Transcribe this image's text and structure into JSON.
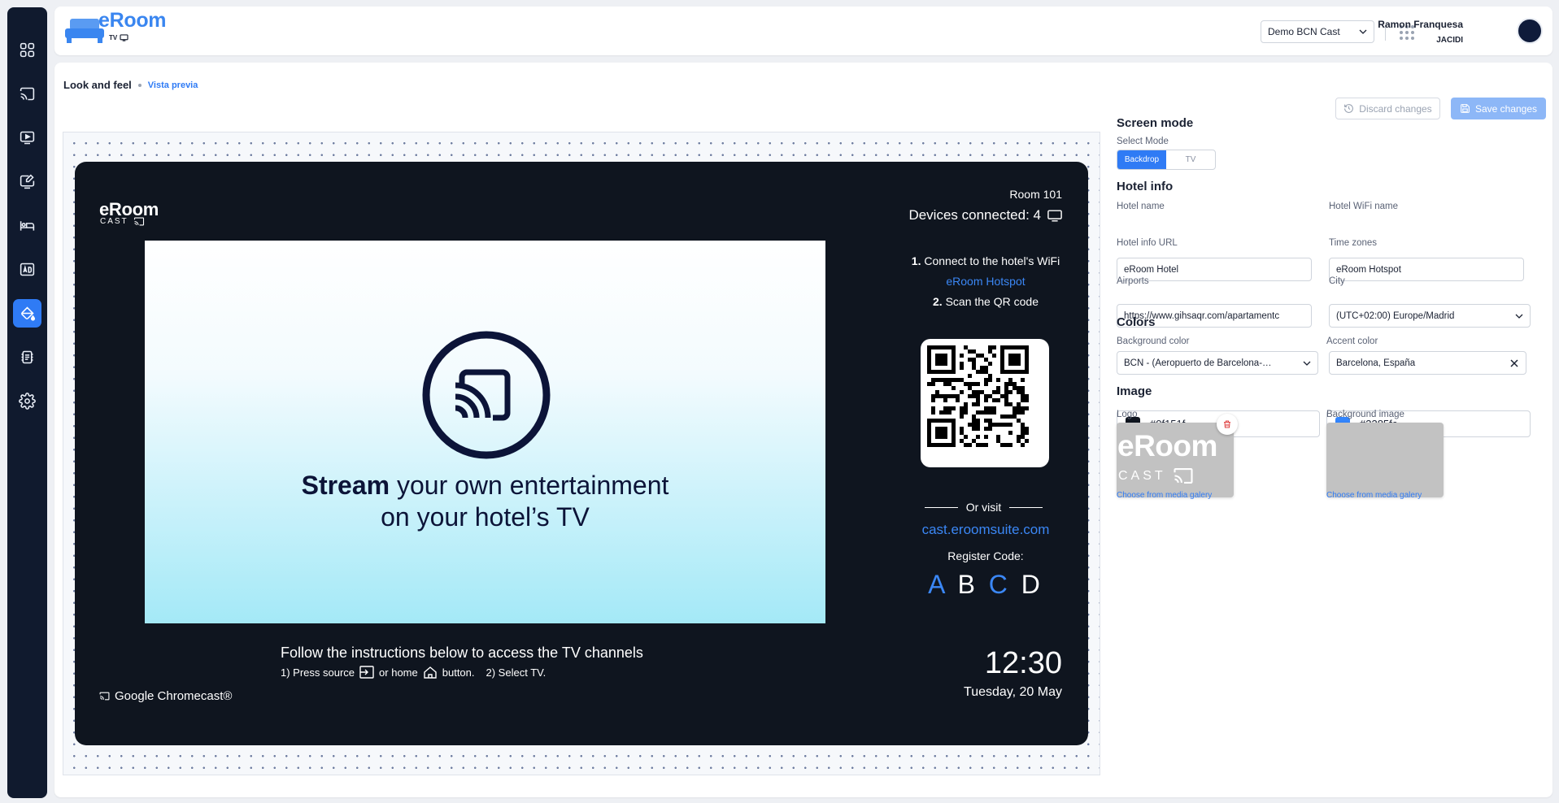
{
  "app": {
    "logo_text": "eRoom",
    "logo_sub": "TV"
  },
  "topbar": {
    "venue_select": "Demo BCN Cast",
    "user_name": "Ramon Franquesa",
    "user_org": "JACIDI"
  },
  "breadcrumb": {
    "title": "Look and feel",
    "sub": "Vista previa"
  },
  "actions": {
    "discard": "Discard changes",
    "save": "Save changes"
  },
  "preview": {
    "logo_text": "eRoom",
    "logo_sub": "CAST",
    "room": "Room 101",
    "devices": "Devices connected: 4",
    "hero_bold": "Stream",
    "hero_rest": " your own entertainment",
    "hero_line2": "on your hotel’s TV",
    "step1_num": "1.",
    "step1_text": " Connect to the hotel's WiFi",
    "wifi_name": "eRoom Hotspot",
    "step2_num": "2.",
    "step2_text": " Scan the QR code",
    "or_visit": "Or visit",
    "site": "cast.eroomsuite.com",
    "register_label": "Register Code:",
    "code": [
      "A",
      "B",
      "C",
      "D"
    ],
    "follow": "Follow the instructions below to access the TV channels",
    "steps_a": "1) Press source",
    "steps_b": "or home",
    "steps_c": "button.",
    "steps_d": "2) Select TV.",
    "time": "12:30",
    "date": "Tuesday, 20 May",
    "chromecast": "Google Chromecast®",
    "bg_color": "#0f151f",
    "accent": "#3385fc"
  },
  "form": {
    "screen_mode_title": "Screen mode",
    "select_mode_label": "Select Mode",
    "modes": [
      "Backdrop",
      "TV"
    ],
    "active_mode": "Backdrop",
    "hotel_info_title": "Hotel info",
    "hotel_name_label": "Hotel name",
    "hotel_name": "eRoom Hotel",
    "wifi_label": "Hotel WiFi name",
    "wifi_value": "eRoom Hotspot",
    "url_label": "Hotel info URL",
    "url_value": "https://www.gihsaqr.com/apartamentc",
    "tz_label": "Time zones",
    "tz_value": "(UTC+02:00) Europe/Madrid",
    "airports_label": "Airports",
    "airports_value": "BCN - (Aeropuerto de Barcelona-…",
    "city_label": "City",
    "city_value": "Barcelona, España",
    "colors_title": "Colors",
    "bg_color_label": "Background color",
    "bg_color_value": "#0f151f",
    "accent_label": "Accent color",
    "accent_value": "#3385fc",
    "image_title": "Image",
    "logo_label": "Logo",
    "logo_preview_text": "eRoom",
    "logo_preview_sub": "CAST",
    "bg_image_label": "Background image",
    "media_link_1": "Choose from media galery",
    "media_link_2": "Choose from media galery"
  }
}
